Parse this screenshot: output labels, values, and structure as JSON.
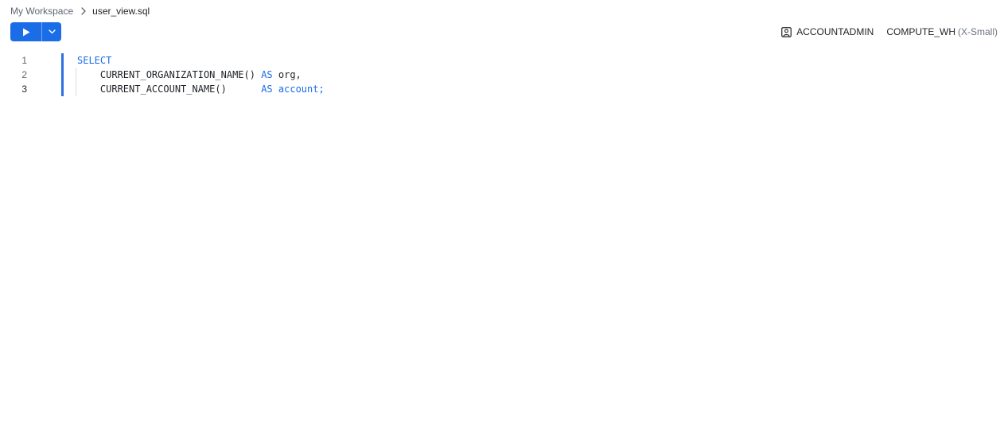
{
  "breadcrumb": {
    "root": "My Workspace",
    "separator_icon": "chevron-right-icon",
    "file": "user_view.sql"
  },
  "toolbar": {
    "run_icon": "play-icon",
    "run_menu_icon": "chevron-down-icon",
    "accent_color": "#1a6ce7"
  },
  "context": {
    "role_icon": "user-badge-icon",
    "role": "ACCOUNTADMIN",
    "warehouse": "COMPUTE_WH",
    "warehouse_size": "(X-Small)"
  },
  "editor": {
    "lines": [
      {
        "number": "1",
        "indent": "",
        "part1": "SELECT",
        "part1_kw": true,
        "part2": "",
        "part3": "",
        "part4": ""
      },
      {
        "number": "2",
        "indent": "    ",
        "part1": "CURRENT_ORGANIZATION_NAME() ",
        "part1_kw": false,
        "part2": "AS",
        "part3": " org,",
        "part4": ""
      },
      {
        "number": "3",
        "indent": "    ",
        "part1": "CURRENT_ACCOUNT_NAME()      ",
        "part1_kw": false,
        "part2": "AS",
        "part3": " ",
        "part4": "account;"
      }
    ],
    "active_line": "3",
    "keyword_color": "#1a6ce7"
  }
}
